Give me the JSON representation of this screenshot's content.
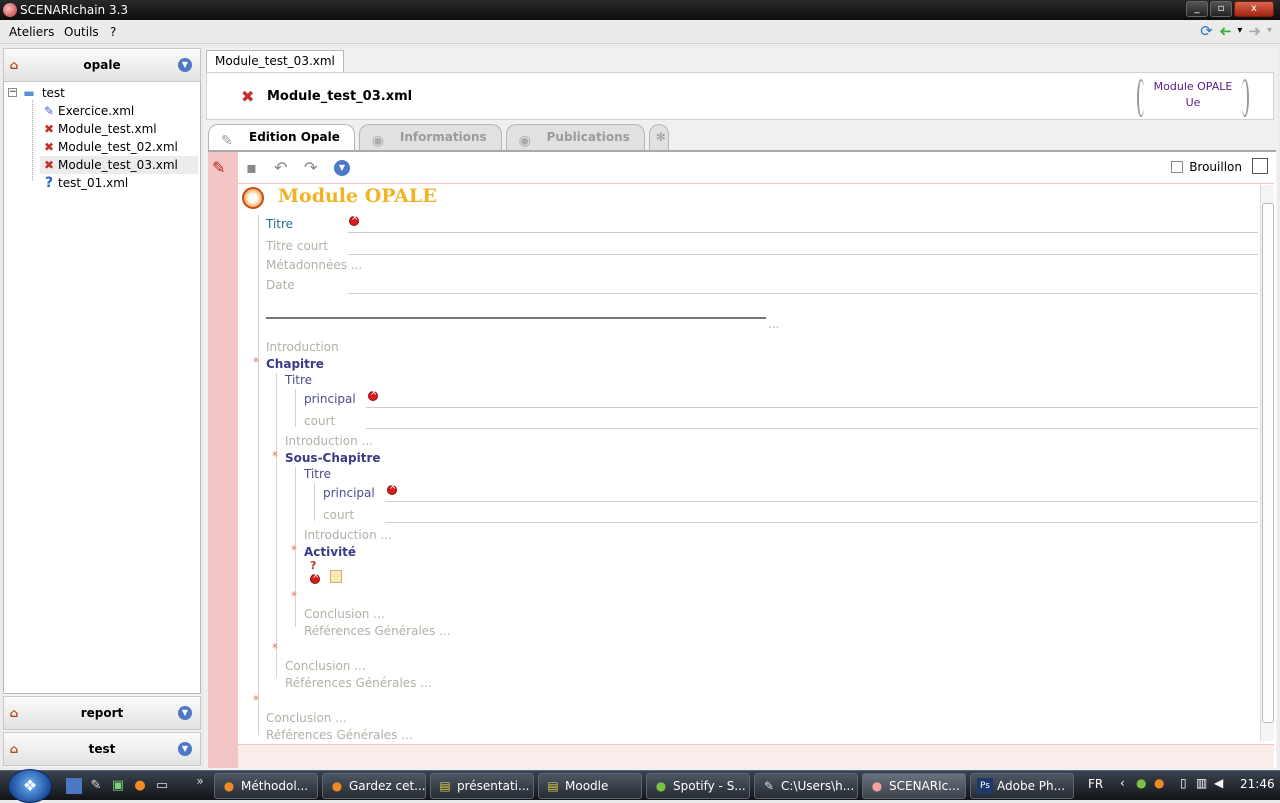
{
  "window": {
    "title": "SCENARIchain 3.3",
    "min": "_",
    "max": "▫",
    "close": "x"
  },
  "menu": {
    "items": [
      "Ateliers",
      "Outils",
      "?"
    ]
  },
  "icons": {
    "refresh": "⟳",
    "back": "➜",
    "forward": "➜",
    "dropdown": "▾",
    "house": "⌂",
    "chevron": "▼",
    "folder": "📁",
    "error_doc": "✖",
    "question": "?",
    "save": "▪",
    "undo": "↶",
    "redo": "↷",
    "pencil": "✎",
    "gear": "✻",
    "eye": "◉"
  },
  "panels": {
    "top": "opale",
    "report": "report",
    "test": "test"
  },
  "tree": {
    "root": "test",
    "items": [
      "Exercice.xml",
      "Module_test.xml",
      "Module_test_02.xml",
      "Module_test_03.xml",
      "test_01.xml"
    ]
  },
  "doc": {
    "tab": "Module_test_03.xml",
    "title": "Module_test_03.xml",
    "badge_line1": "Module OPALE",
    "badge_line2": "Ue"
  },
  "editor_tabs": [
    "Edition Opale",
    "Informations",
    "Publications"
  ],
  "toolbar": {
    "brouillon": "Brouillon"
  },
  "content": {
    "module_title": "Module OPALE",
    "titre": "Titre",
    "titre_court": "Titre court",
    "metadonnees": "Métadonnées ...",
    "date": "Date",
    "ellipsis": "...",
    "introduction": "Introduction",
    "chapitre": "Chapitre",
    "ch_titre": "Titre",
    "principal": "principal",
    "court": "court",
    "introduction_dots": "Introduction ...",
    "sous_chapitre": "Sous-Chapitre",
    "activite": "Activité",
    "conclusion": "Conclusion ...",
    "references": "Références Générales ...",
    "star": "*"
  },
  "taskbar": {
    "items": [
      "Méthodol...",
      "Gardez cet...",
      "présentati...",
      "Moodle",
      "Spotify - S...",
      "C:\\Users\\h...",
      "SCENARIc...",
      "Adobe Ph..."
    ],
    "lang": "FR",
    "time": "21:46",
    "arrows": "»"
  },
  "colors": {
    "accent_title": "#f0b323",
    "pink_bar": "#f2c6c6",
    "chapter_text": "#3a3a86"
  }
}
